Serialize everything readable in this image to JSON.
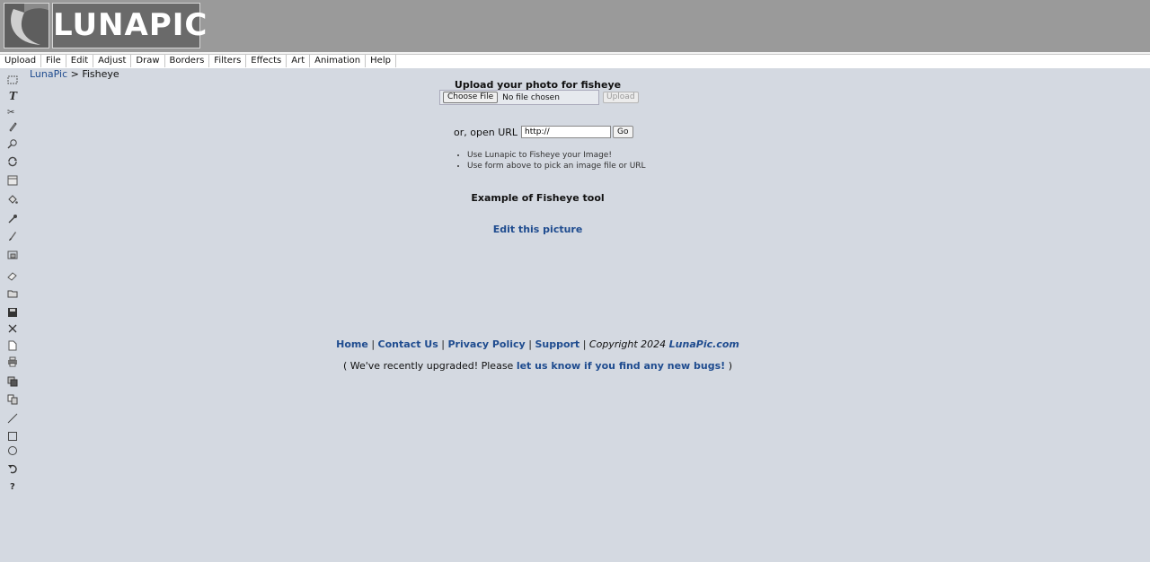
{
  "logo": {
    "text": "LUNAPIC"
  },
  "menu": [
    "Upload",
    "File",
    "Edit",
    "Adjust",
    "Draw",
    "Borders",
    "Filters",
    "Effects",
    "Art",
    "Animation",
    "Help"
  ],
  "toolbar_icons": [
    "marquee-select-icon",
    "text-icon",
    "scissors-icon",
    "pencil-icon",
    "zoom-icon",
    "rotate-icon",
    "crop-icon",
    "paint-bucket-icon",
    "eyedropper-icon",
    "brush-icon",
    "resize-icon",
    "eraser-icon",
    "open-folder-icon",
    "save-icon",
    "close-icon",
    "new-file-icon",
    "print-icon",
    "layers-icon",
    "copy-icon",
    "line-icon",
    "rectangle-icon",
    "circle-icon",
    "undo-icon",
    "help-icon"
  ],
  "breadcrumb": {
    "home": "LunaPic",
    "separator": ">",
    "current": "Fisheye"
  },
  "upload": {
    "title": "Upload your photo for fisheye",
    "choose_label": "Choose File",
    "file_status": "No file chosen",
    "upload_label": "Upload"
  },
  "url": {
    "label": "or, open URL",
    "value": "http://",
    "go_label": "Go"
  },
  "tips": [
    "Use Lunapic to Fisheye your Image!",
    "Use form above to pick an image file or URL"
  ],
  "example_title": "Example of Fisheye tool",
  "edit_link": "Edit this picture",
  "footer": {
    "home": "Home",
    "contact": "Contact Us",
    "privacy": "Privacy Policy",
    "support": "Support",
    "sep": "|",
    "copyright": "Copyright 2024",
    "brand": "LunaPic.com"
  },
  "upgrade": {
    "prefix": "( We've recently upgraded! Please",
    "link": "let us know if you find any new bugs!",
    "suffix": ")"
  },
  "colors": {
    "link": "#1f4c8f",
    "background": "#d4d9e1",
    "header": "#9a9a9a"
  }
}
